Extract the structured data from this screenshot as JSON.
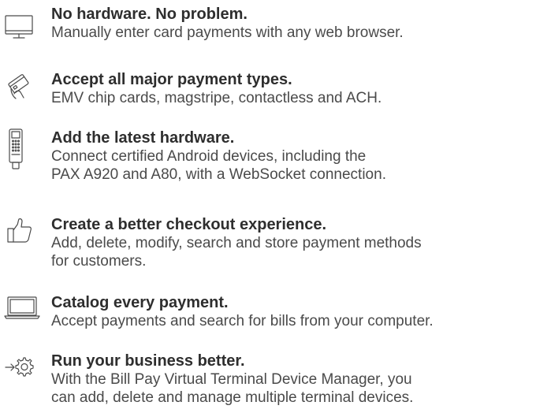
{
  "features": [
    {
      "icon": "monitor-icon",
      "title": "No hardware. No problem.",
      "description": "Manually enter card payments with any web browser."
    },
    {
      "icon": "card-in-hand-icon",
      "title": "Accept all major payment types.",
      "description": "EMV chip cards, magstripe, contactless and ACH."
    },
    {
      "icon": "card-terminal-icon",
      "title": "Add the latest hardware.",
      "description": "Connect certified Android devices, including the\nPAX A920 and A80, with a WebSocket connection."
    },
    {
      "icon": "thumbs-up-icon",
      "title": "Create a better checkout experience.",
      "description": "Add, delete, modify, search and store payment methods\nfor customers."
    },
    {
      "icon": "laptop-icon",
      "title": "Catalog every payment.",
      "description": "Accept payments and search for bills from your computer."
    },
    {
      "icon": "gear-arrow-icon",
      "title": "Run your business better.",
      "description": "With the Bill Pay Virtual Terminal Device Manager, you\ncan add, delete and manage multiple terminal devices."
    }
  ]
}
